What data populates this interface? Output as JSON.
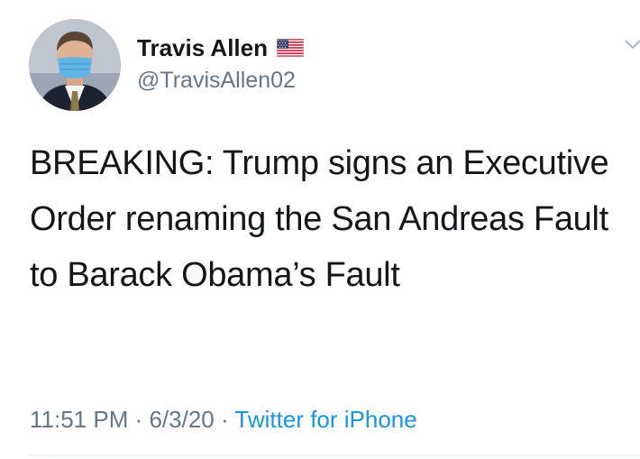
{
  "author": {
    "display_name": "Travis Allen",
    "handle": "@TravisAllen02",
    "badge_icon": "us-flag-icon",
    "avatar_icon": "profile-photo"
  },
  "tweet": {
    "text": "BREAKING: Trump signs an Executive Order renaming the San Andreas Fault to Barack Obama’s Fault",
    "time": "11:51 PM",
    "separator1": " · ",
    "date": "6/3/20",
    "separator2": " · ",
    "source": "Twitter for iPhone"
  },
  "menu": {
    "icon": "chevron-down-icon"
  },
  "colors": {
    "text": "#14171a",
    "secondary": "#657786",
    "link": "#1b95e0"
  }
}
